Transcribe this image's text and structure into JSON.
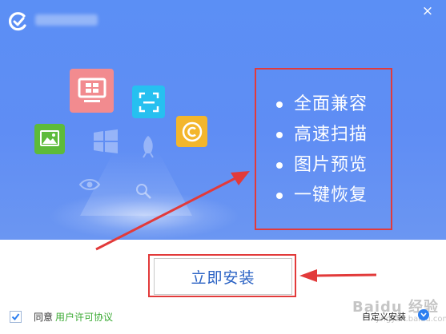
{
  "window": {
    "close_glyph": "×"
  },
  "features": {
    "items": [
      {
        "label": "全面兼容"
      },
      {
        "label": "高速扫描"
      },
      {
        "label": "图片预览"
      },
      {
        "label": "一键恢复"
      }
    ]
  },
  "install": {
    "button_label": "立即安装"
  },
  "footer": {
    "agree_label": "同意",
    "license_link": "用户许可协议",
    "custom_install_label": "自定义安装",
    "checkbox_checked": true
  },
  "watermark": {
    "text": "Baidu 经验",
    "sub": "jingyan.baidu.com"
  },
  "colors": {
    "hero_blue": "#5b8ff5",
    "annotation_red": "#e23a3a",
    "install_text": "#2a62c4",
    "license_green": "#3cab35"
  },
  "icons": [
    "app-logo-icon",
    "monitor-icon",
    "scan-icon",
    "copyright-icon",
    "image-icon",
    "windows-icon",
    "rocket-icon",
    "magnifier-icon",
    "eye-icon",
    "close-icon",
    "chevron-down-icon",
    "checkmark-icon"
  ]
}
